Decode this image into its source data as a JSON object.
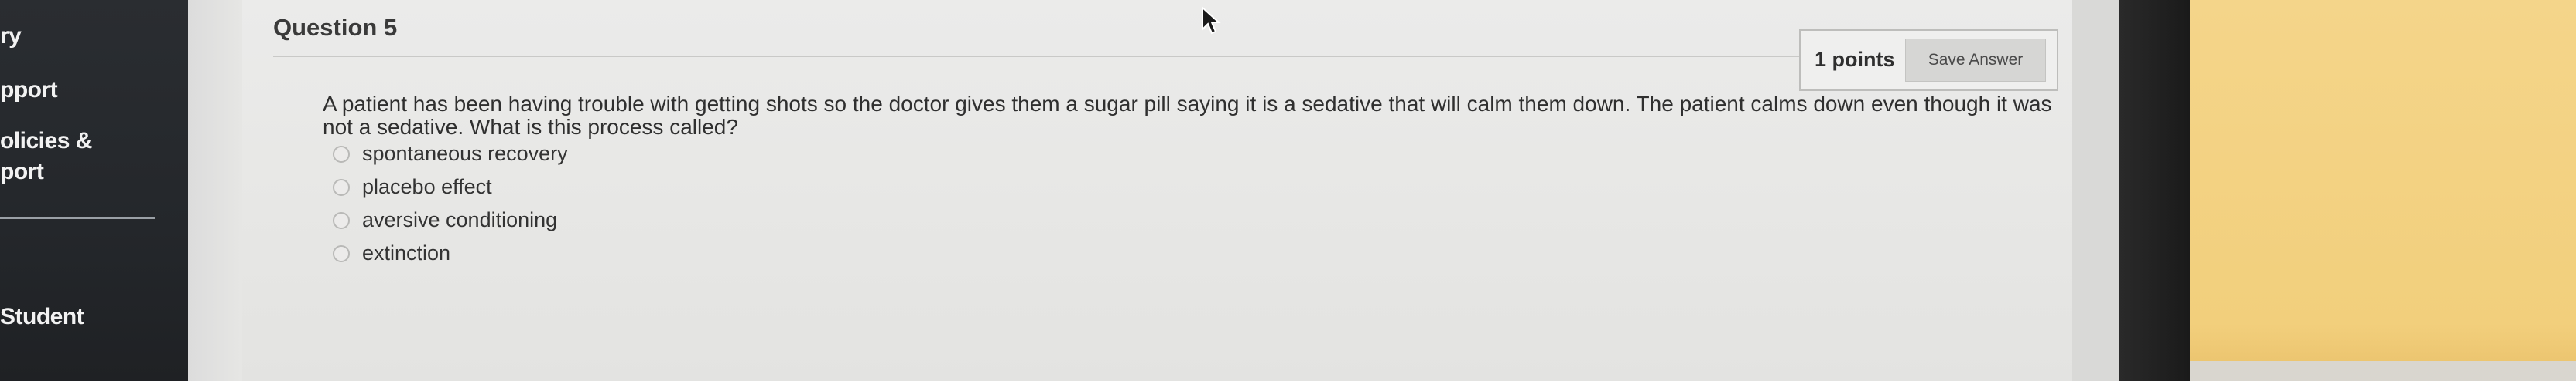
{
  "sidebar": {
    "items": [
      {
        "label": "ry"
      },
      {
        "label": "pport"
      },
      {
        "label": "olicies &"
      },
      {
        "label": "port"
      },
      {
        "label": "Student"
      }
    ]
  },
  "question": {
    "title": "Question 5",
    "points": "1 points",
    "save_label": "Save Answer",
    "prompt": "A patient has been having trouble with getting shots so the doctor gives them a sugar pill saying it is a sedative that will calm them down. The patient calms down even though it was not a sedative. What is this process called?",
    "options": [
      {
        "label": "spontaneous recovery"
      },
      {
        "label": "placebo effect"
      },
      {
        "label": "aversive conditioning"
      },
      {
        "label": "extinction"
      }
    ]
  }
}
